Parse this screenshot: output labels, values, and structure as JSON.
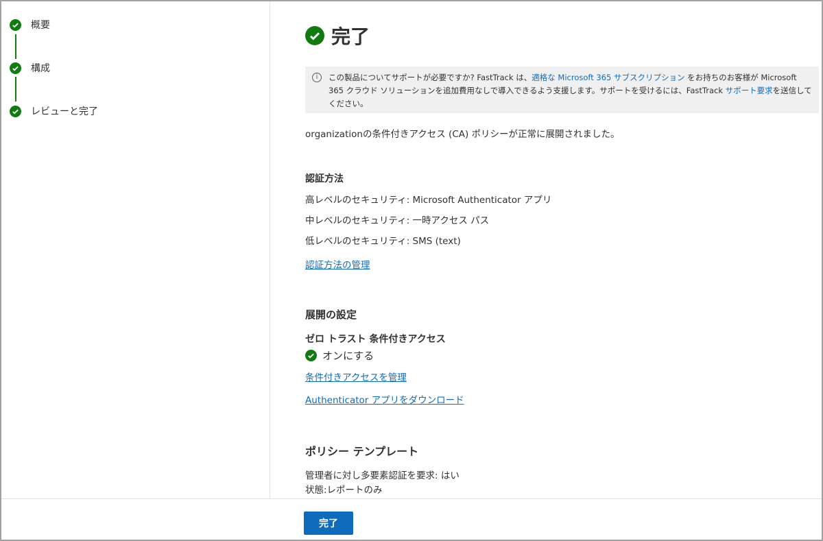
{
  "steps": [
    "概要",
    "構成",
    "レビューと完了"
  ],
  "title": "完了",
  "info": {
    "p1": "この製品についてサポートが必要ですか? FastTrack は、",
    "link1": "適格な Microsoft 365 サブスクリプション",
    "p2": " をお持ちのお客様が Microsoft 365 クラウド ソリューションを追加費用なしで導入できるよう支援します。サポートを受けるには、FastTrack ",
    "link2": "サポート要求",
    "p3": "を送信してください。"
  },
  "summary": "organizationの条件付きアクセス (CA) ポリシーが正常に展開されました。",
  "auth": {
    "heading": "認証方法",
    "high": "高レベルのセキュリティ: Microsoft Authenticator アプリ",
    "mid": "中レベルのセキュリティ: 一時アクセス パス",
    "low": "低レベルのセキュリティ: SMS (text)",
    "link": "認証方法の管理"
  },
  "deploy": {
    "heading": "展開の設定",
    "sub": "ゼロ トラスト 条件付きアクセス",
    "status": "オンにする",
    "link1": "条件付きアクセスを管理",
    "link2": "Authenticator アプリをダウンロード"
  },
  "policy": {
    "heading": "ポリシー テンプレート",
    "line1": "管理者に対し多要素認証を要求: はい",
    "line2": "状態:レポートのみ"
  },
  "done_button": "完了"
}
